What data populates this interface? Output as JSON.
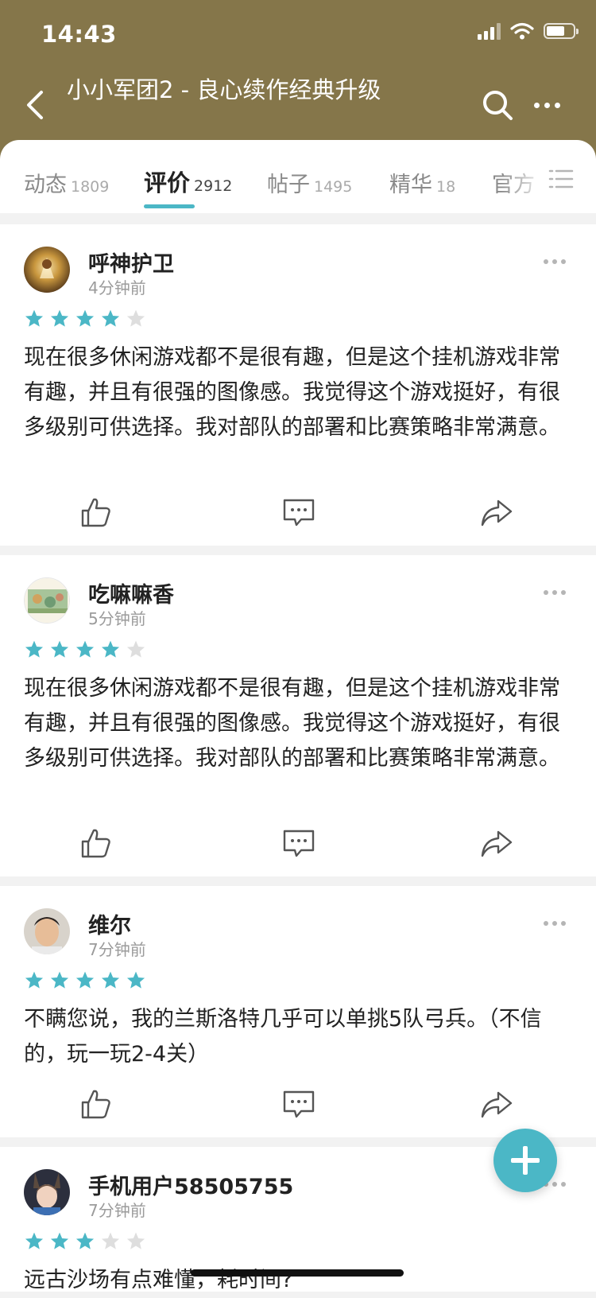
{
  "status_bar": {
    "time": "14:43"
  },
  "header": {
    "title": "小小军团2 - 良心续作经典升级"
  },
  "tabs": [
    {
      "label": "动态",
      "count": "1809"
    },
    {
      "label": "评价",
      "count": "2912"
    },
    {
      "label": "帖子",
      "count": "1495"
    },
    {
      "label": "精华",
      "count": "18"
    },
    {
      "label": "官方",
      "count": ""
    }
  ],
  "colors": {
    "header_bg": "#85764a",
    "accent": "#4bb7c6",
    "star_off": "#dedede"
  },
  "reviews": [
    {
      "user": "呼神护卫",
      "time": "4分钟前",
      "rating": 4,
      "text": "现在很多休闲游戏都不是很有趣，但是这个挂机游戏非常有趣，并且有很强的图像感。我觉得这个游戏挺好，有很多级别可供选择。我对部队的部署和比赛策略非常满意。"
    },
    {
      "user": "吃嘛嘛香",
      "time": "5分钟前",
      "rating": 4,
      "text": "现在很多休闲游戏都不是很有趣，但是这个挂机游戏非常有趣，并且有很强的图像感。我觉得这个游戏挺好，有很多级别可供选择。我对部队的部署和比赛策略非常满意。"
    },
    {
      "user": "维尔",
      "time": "7分钟前",
      "rating": 5,
      "text": "不瞒您说，我的兰斯洛特几乎可以单挑5队弓兵。（不信的，玩一玩2-4关）"
    },
    {
      "user": "手机用户58505755",
      "time": "7分钟前",
      "rating": 3,
      "text": "远古沙场有点难懂，耗时间?"
    }
  ]
}
